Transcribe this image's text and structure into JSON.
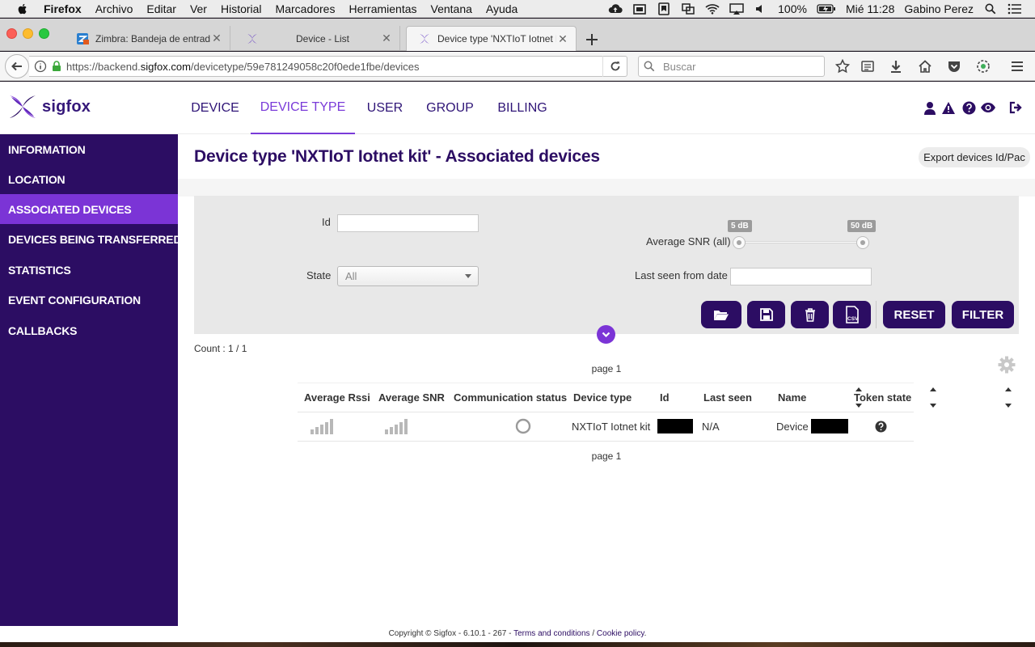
{
  "os_menubar": {
    "app_name": "Firefox",
    "menus": [
      "Archivo",
      "Editar",
      "Ver",
      "Historial",
      "Marcadores",
      "Herramientas",
      "Ventana",
      "Ayuda"
    ],
    "battery": "100%",
    "clock": "Mié 11:28",
    "user": "Gabino Perez"
  },
  "browser": {
    "tabs": [
      {
        "title": "Zimbra: Bandeja de entrada (",
        "active": false
      },
      {
        "title": "Device - List",
        "active": false
      },
      {
        "title": "Device type 'NXTIoT Iotnet ki",
        "active": true
      }
    ],
    "url_prefix": "https://backend.",
    "url_domain": "sigfox.com",
    "url_suffix": "/devicetype/59e781249058c20f0ede1fbe/devices",
    "search_placeholder": "Buscar"
  },
  "app": {
    "logo_text": "sigfox",
    "nav": [
      {
        "label": "DEVICE",
        "active": false
      },
      {
        "label": "DEVICE TYPE",
        "active": true
      },
      {
        "label": "USER",
        "active": false
      },
      {
        "label": "GROUP",
        "active": false
      },
      {
        "label": "BILLING",
        "active": false
      }
    ],
    "sidebar": [
      {
        "label": "INFORMATION",
        "active": false
      },
      {
        "label": "LOCATION",
        "active": false
      },
      {
        "label": "ASSOCIATED DEVICES",
        "active": true
      },
      {
        "label": "DEVICES BEING TRANSFERRED",
        "active": false
      },
      {
        "label": "STATISTICS",
        "active": false
      },
      {
        "label": "EVENT CONFIGURATION",
        "active": false
      },
      {
        "label": "CALLBACKS",
        "active": false
      }
    ],
    "page_title": "Device type 'NXTIoT Iotnet kit' - Associated devices",
    "export_button": "Export devices Id/Pac",
    "filters": {
      "id_label": "Id",
      "id_value": "",
      "state_label": "State",
      "state_value": "All",
      "snr_label": "Average SNR (all)",
      "snr_min": "5 dB",
      "snr_max": "50 dB",
      "last_seen_label": "Last seen from date",
      "last_seen_value": "",
      "reset_button": "RESET",
      "filter_button": "FILTER",
      "csv_icon_text": "CSV"
    },
    "count_text": "Count : 1 / 1",
    "pager_text": "page 1",
    "table": {
      "headers": [
        "Average Rssi",
        "Average SNR",
        "Communication status",
        "Device type",
        "Id",
        "Last seen",
        "Name",
        "Token state"
      ],
      "rows": [
        {
          "rssi_icon": "signal-bars-icon",
          "snr_icon": "signal-bars-icon",
          "comm_status_icon": "empty-circle-icon",
          "device_type": "NXTIoT Iotnet kit",
          "id": "[redacted]",
          "last_seen": "N/A",
          "name": "Device",
          "name_suffix": "[redacted]",
          "token_state_icon": "question-circle-icon"
        }
      ]
    },
    "footer": {
      "copyright": "Copyright © Sigfox - 6.10.1 - 267 - ",
      "terms": "Terms and conditions",
      "separator": " / ",
      "cookie": "Cookie policy",
      "end": "."
    }
  },
  "colors": {
    "brand_dark": "#2c0d63",
    "brand_accent": "#7b34d6",
    "panel_gray": "#e8e8e8"
  }
}
